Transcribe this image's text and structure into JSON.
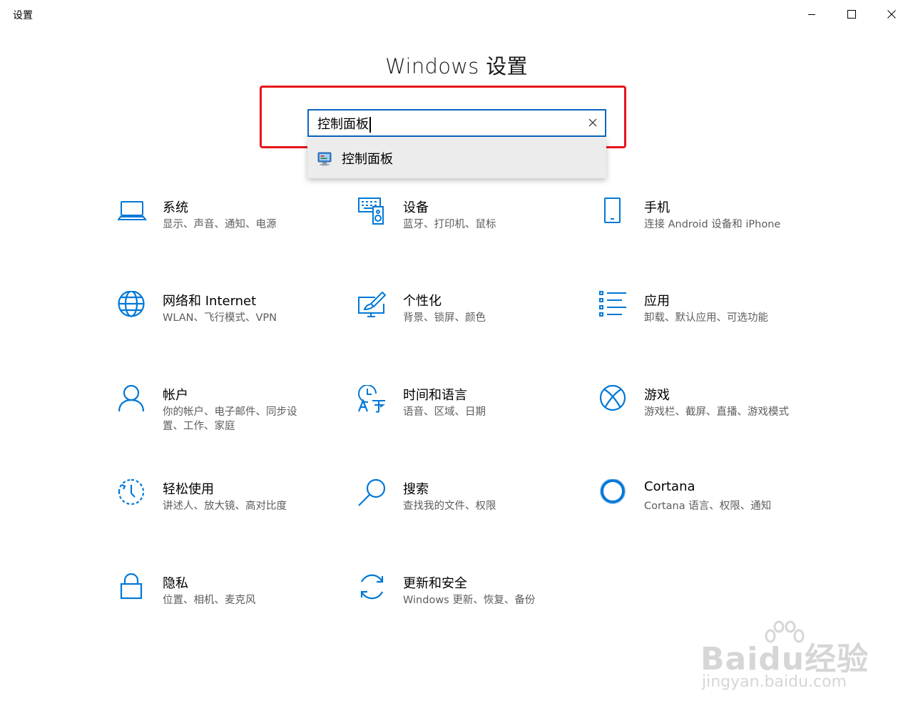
{
  "window": {
    "app_title": "设置",
    "main_title": "Windows 设置"
  },
  "search": {
    "value": "控制面板",
    "suggestion": "控制面板"
  },
  "tiles": [
    {
      "title": "系统",
      "desc": "显示、声音、通知、电源",
      "icon": "laptop-icon"
    },
    {
      "title": "设备",
      "desc": "蓝牙、打印机、鼠标",
      "icon": "devices-icon"
    },
    {
      "title": "手机",
      "desc": "连接 Android 设备和 iPhone",
      "icon": "phone-icon"
    },
    {
      "title": "网络和 Internet",
      "desc": "WLAN、飞行模式、VPN",
      "icon": "globe-icon"
    },
    {
      "title": "个性化",
      "desc": "背景、锁屏、颜色",
      "icon": "paint-brush-icon"
    },
    {
      "title": "应用",
      "desc": "卸载、默认应用、可选功能",
      "icon": "apps-list-icon"
    },
    {
      "title": "帐户",
      "desc": "你的帐户、电子邮件、同步设置、工作、家庭",
      "icon": "person-icon"
    },
    {
      "title": "时间和语言",
      "desc": "语音、区域、日期",
      "icon": "time-language-icon"
    },
    {
      "title": "游戏",
      "desc": "游戏栏、截屏、直播、游戏模式",
      "icon": "xbox-icon"
    },
    {
      "title": "轻松使用",
      "desc": "讲述人、放大镜、高对比度",
      "icon": "ease-of-access-icon"
    },
    {
      "title": "搜索",
      "desc": "查找我的文件、权限",
      "icon": "magnifier-icon"
    },
    {
      "title": "Cortana",
      "desc": "Cortana 语言、权限、通知",
      "icon": "cortana-icon"
    },
    {
      "title": "隐私",
      "desc": "位置、相机、麦克风",
      "icon": "lock-icon"
    },
    {
      "title": "更新和安全",
      "desc": "Windows 更新、恢复、备份",
      "icon": "update-icon"
    }
  ],
  "watermark": {
    "brand": "Baidu经验",
    "url": "jingyan.baidu.com"
  },
  "colors": {
    "accent": "#0078d7",
    "highlight": "#e8141b"
  }
}
